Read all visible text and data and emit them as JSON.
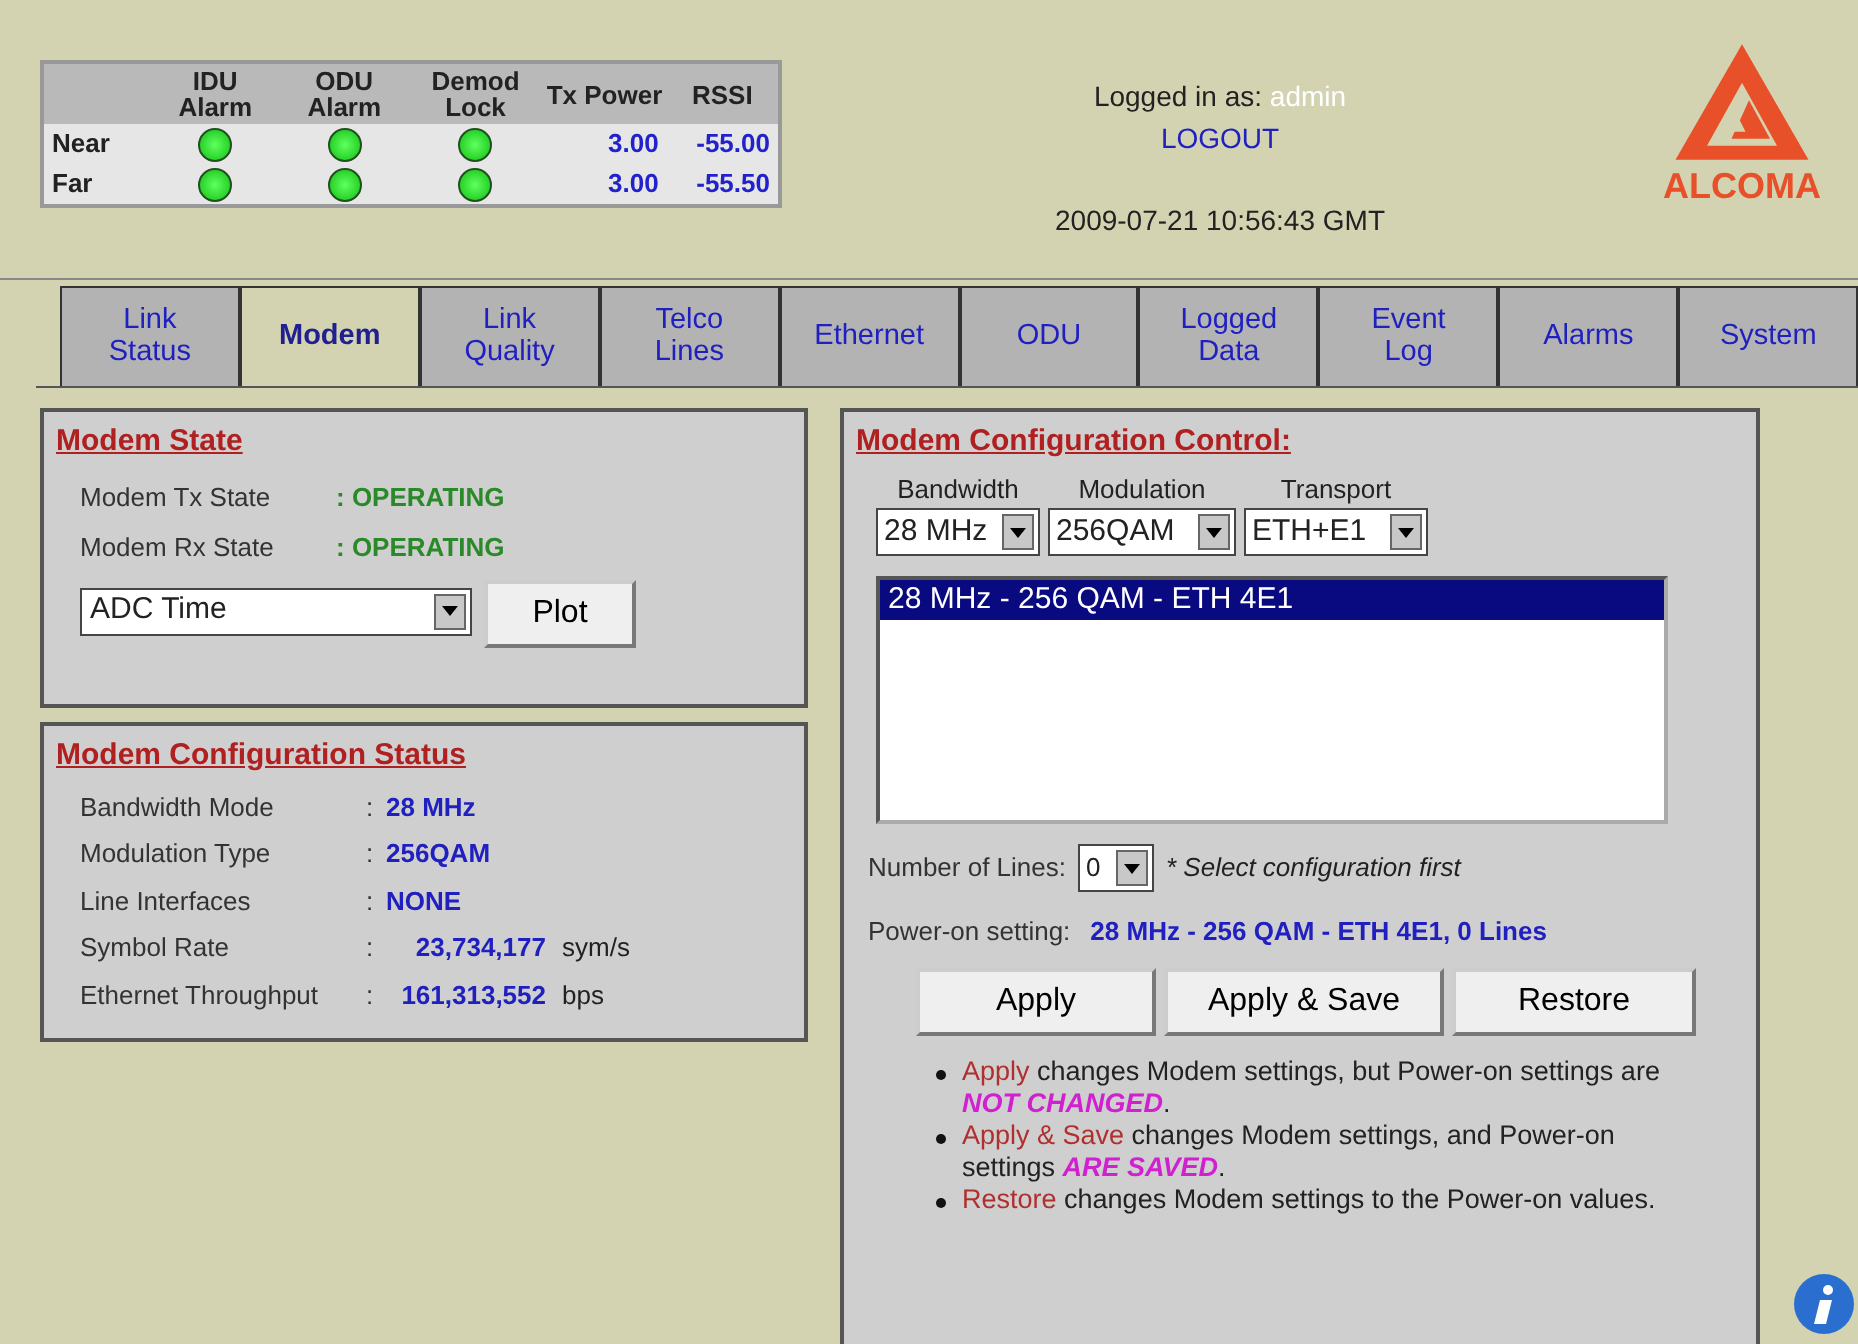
{
  "status_table": {
    "columns": [
      "",
      "IDU Alarm",
      "ODU Alarm",
      "Demod Lock",
      "Tx Power",
      "RSSI"
    ],
    "rows": [
      {
        "label": "Near",
        "idu_alarm_ok": true,
        "odu_alarm_ok": true,
        "demod_lock_ok": true,
        "tx_power": "3.00",
        "rssi": "-55.00"
      },
      {
        "label": "Far",
        "idu_alarm_ok": true,
        "odu_alarm_ok": true,
        "demod_lock_ok": true,
        "tx_power": "3.00",
        "rssi": "-55.50"
      }
    ]
  },
  "session": {
    "logged_in_label": "Logged in as:",
    "user": "admin",
    "logout": "LOGOUT",
    "datetime": "2009-07-21 10:56:43 GMT"
  },
  "logo": {
    "text": "ALCOMA"
  },
  "tabs": [
    {
      "label": "Link Status",
      "selected": false
    },
    {
      "label": "Modem",
      "selected": true
    },
    {
      "label": "Link Quality",
      "selected": false
    },
    {
      "label": "Telco Lines",
      "selected": false
    },
    {
      "label": "Ethernet",
      "selected": false
    },
    {
      "label": "ODU",
      "selected": false
    },
    {
      "label": "Logged Data",
      "selected": false
    },
    {
      "label": "Event Log",
      "selected": false
    },
    {
      "label": "Alarms",
      "selected": false
    },
    {
      "label": "System",
      "selected": false
    }
  ],
  "modem_state": {
    "title": "Modem State",
    "rows": [
      {
        "label": "Modem Tx State",
        "value": ": OPERATING"
      },
      {
        "label": "Modem Rx State",
        "value": ": OPERATING"
      }
    ],
    "plot_select": "ADC Time",
    "plot_button": "Plot"
  },
  "config_status": {
    "title": "Modem Configuration Status",
    "rows": [
      {
        "label": "Bandwidth Mode",
        "separator": ":",
        "value": "28 MHz"
      },
      {
        "label": "Modulation Type",
        "separator": ":",
        "value": "256QAM"
      },
      {
        "label": "Line Interfaces",
        "separator": ":",
        "value": "NONE"
      },
      {
        "label": "Symbol Rate",
        "separator": ":",
        "value": "23,734,177",
        "unit": "sym/s"
      },
      {
        "label": "Ethernet Throughput",
        "separator": ":",
        "value": "161,313,552",
        "unit": "bps"
      }
    ]
  },
  "config_control": {
    "title": "Modem Configuration Control:",
    "selects": [
      {
        "label": "Bandwidth",
        "value": "28 MHz"
      },
      {
        "label": "Modulation",
        "value": "256QAM"
      },
      {
        "label": "Transport",
        "value": "ETH+E1"
      }
    ],
    "options": [
      {
        "label": "28 MHz - 256 QAM - ETH 4E1",
        "selected": true
      }
    ],
    "lines_label": "Number of Lines:",
    "lines_value": "0",
    "lines_hint": "* Select configuration first",
    "power_on_label": "Power-on setting:",
    "power_on_value": "28 MHz - 256 QAM - ETH 4E1, 0 Lines",
    "buttons": [
      "Apply",
      "Apply & Save",
      "Restore"
    ],
    "notes": [
      [
        {
          "kind": "action",
          "text": "Apply"
        },
        {
          "kind": "plain",
          "text": " changes Modem settings, but Power-on settings are "
        },
        {
          "kind": "emphasis",
          "text": "NOT CHANGED"
        },
        {
          "kind": "plain",
          "text": "."
        }
      ],
      [
        {
          "kind": "action",
          "text": "Apply & Save"
        },
        {
          "kind": "plain",
          "text": " changes Modem settings, and Power-on settings "
        },
        {
          "kind": "emphasis",
          "text": "ARE SAVED"
        },
        {
          "kind": "plain",
          "text": "."
        }
      ],
      [
        {
          "kind": "action",
          "text": "Restore"
        },
        {
          "kind": "plain",
          "text": " changes Modem settings to the Power-on values."
        }
      ]
    ]
  }
}
